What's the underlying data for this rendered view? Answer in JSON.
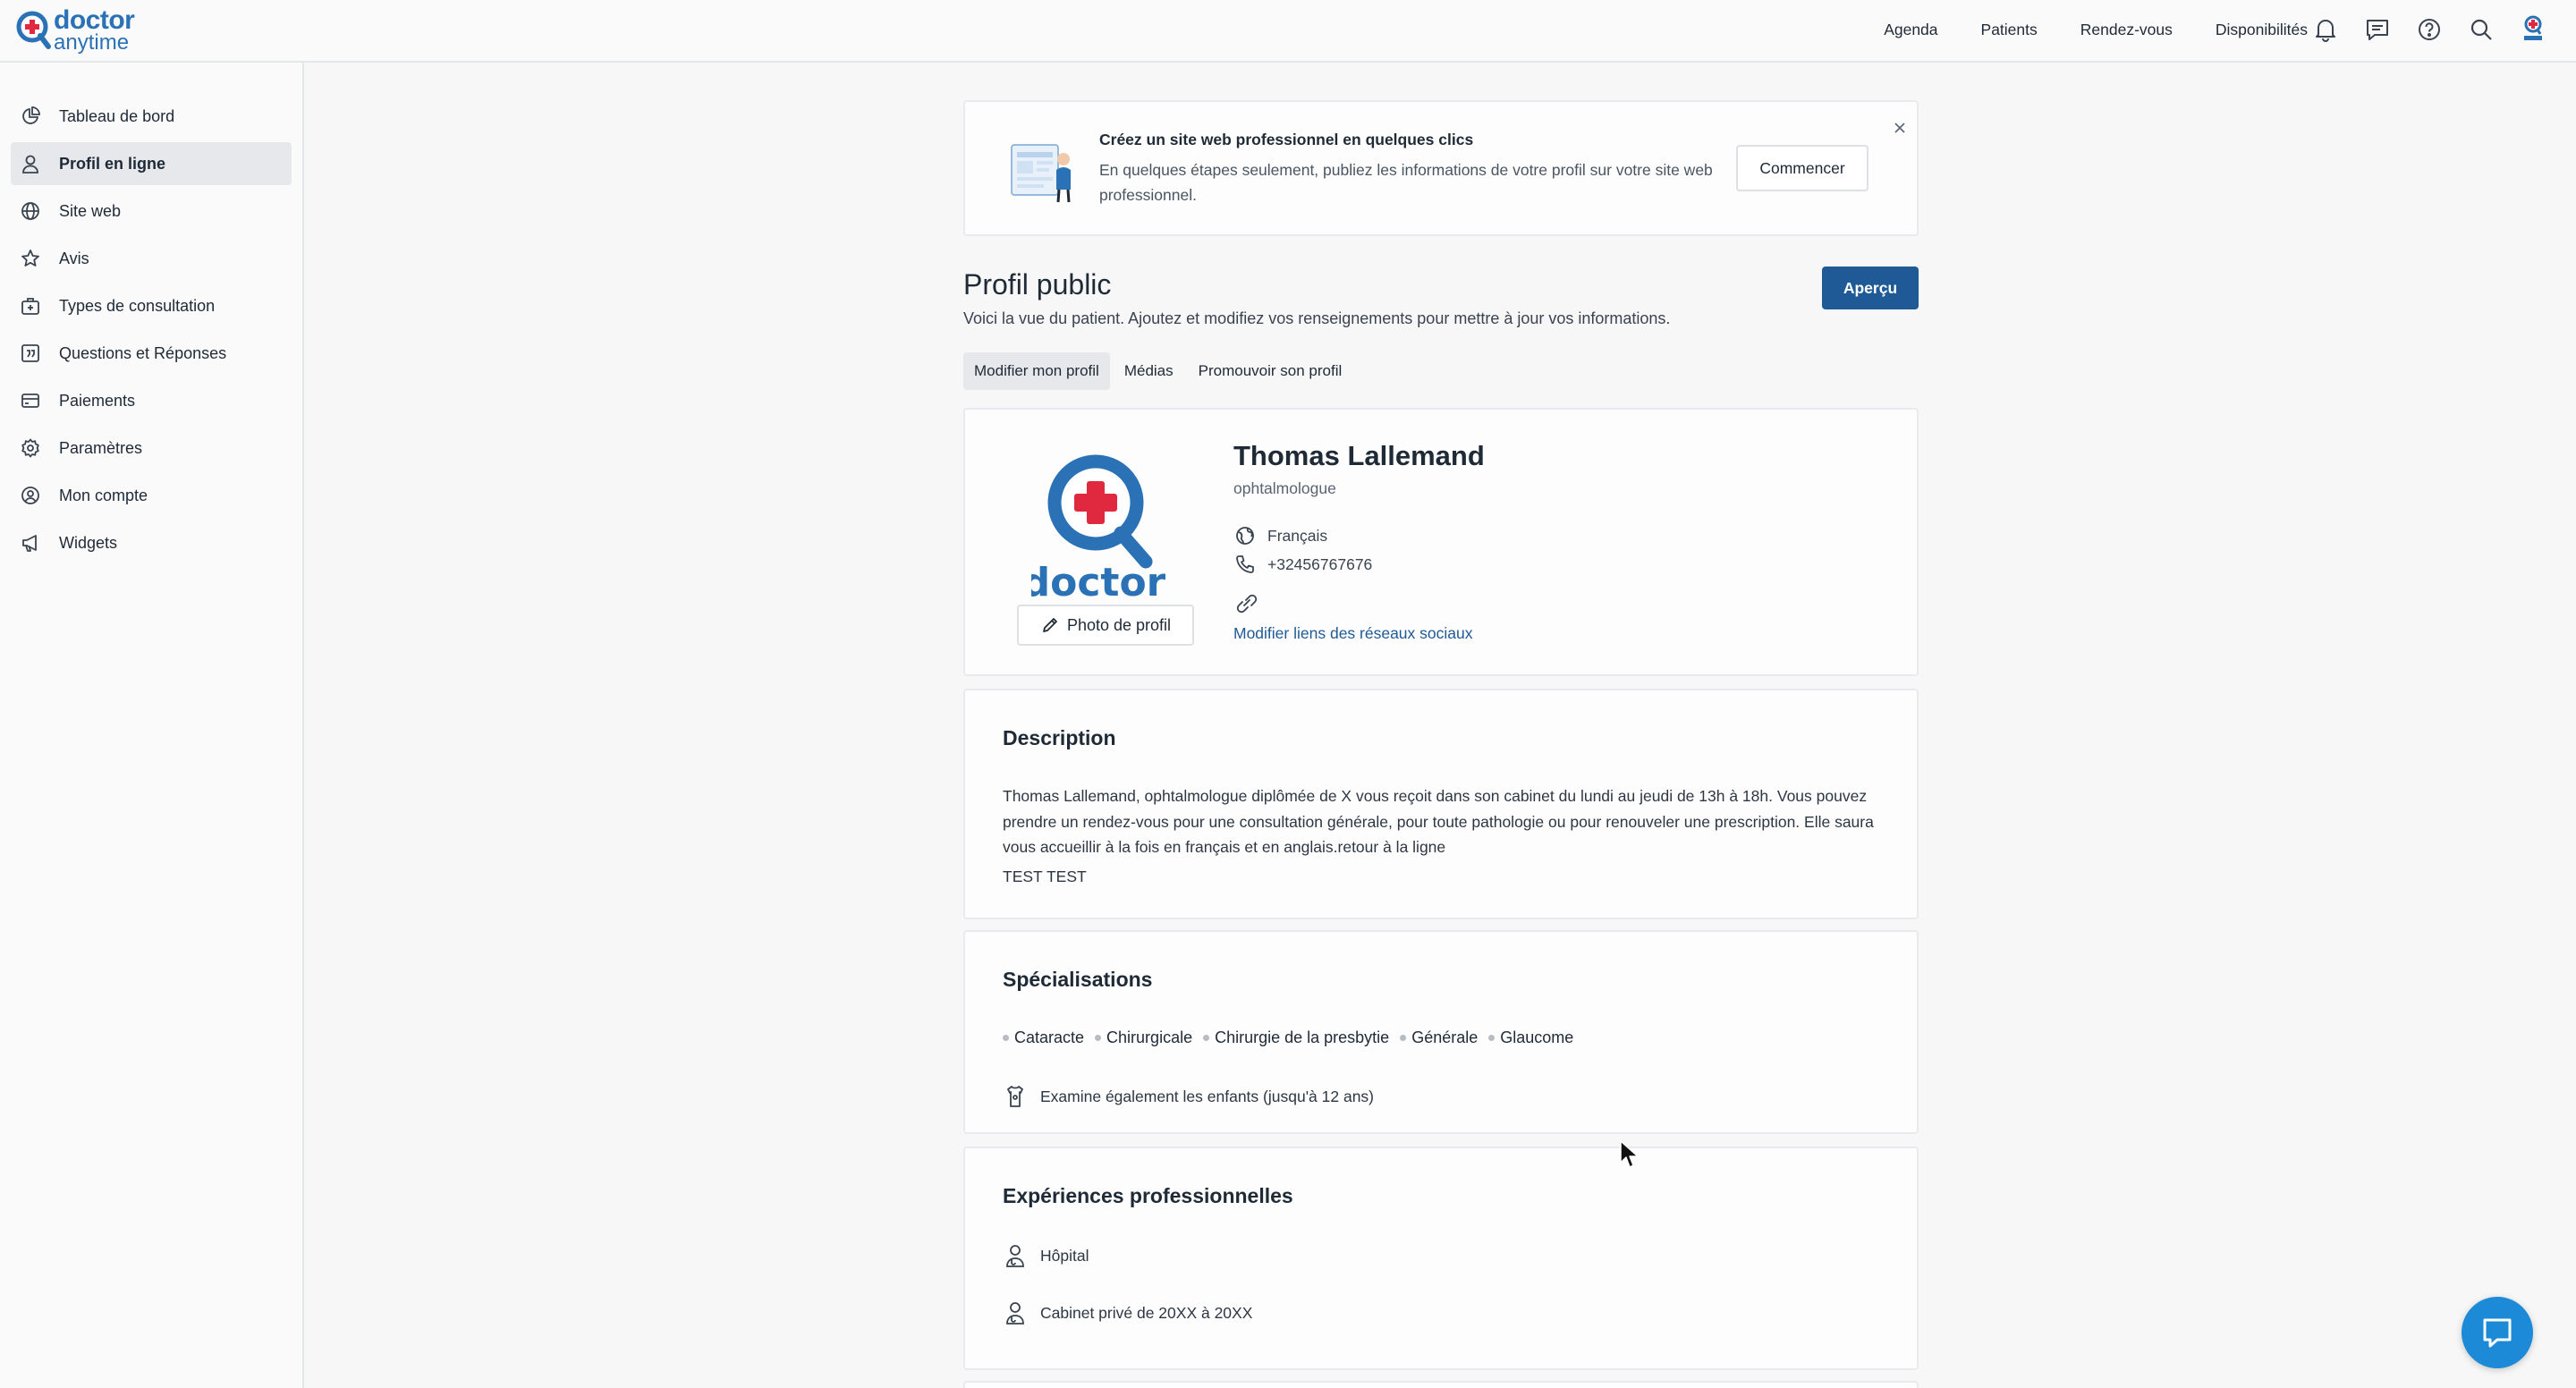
{
  "brand": {
    "line1": "doctor",
    "line2": "anytime",
    "color": "#2a72b5"
  },
  "nav": {
    "links": [
      "Agenda",
      "Patients",
      "Rendez-vous",
      "Disponibilités"
    ],
    "icons": [
      "bell-icon",
      "message-icon",
      "help-icon",
      "search-icon",
      "avatar-icon"
    ]
  },
  "sidebar": {
    "items": [
      {
        "label": "Tableau de bord",
        "icon": "pie-chart-icon",
        "active": false
      },
      {
        "label": "Profil en ligne",
        "icon": "user-icon",
        "active": true
      },
      {
        "label": "Site web",
        "icon": "globe-icon",
        "active": false
      },
      {
        "label": "Avis",
        "icon": "star-icon",
        "active": false
      },
      {
        "label": "Types de consultation",
        "icon": "medical-bag-icon",
        "active": false
      },
      {
        "label": "Questions et Réponses",
        "icon": "quote-icon",
        "active": false
      },
      {
        "label": "Paiements",
        "icon": "card-icon",
        "active": false
      },
      {
        "label": "Paramètres",
        "icon": "gear-icon",
        "active": false
      },
      {
        "label": "Mon compte",
        "icon": "account-icon",
        "active": false
      },
      {
        "label": "Widgets",
        "icon": "megaphone-icon",
        "active": false
      }
    ]
  },
  "banner": {
    "title": "Créez un site web professionnel en quelques clics",
    "text": "En quelques étapes seulement, publiez les informations de votre profil sur votre site web professionnel.",
    "button": "Commencer"
  },
  "page": {
    "title": "Profil public",
    "subtitle": "Voici la vue du patient. Ajoutez et modifiez vos renseignements pour mettre à jour vos informations.",
    "preview_button": "Aperçu",
    "tabs": [
      {
        "label": "Modifier mon profil",
        "active": true
      },
      {
        "label": "Médias",
        "active": false
      },
      {
        "label": "Promouvoir son profil",
        "active": false
      }
    ]
  },
  "profile": {
    "name": "Thomas Lallemand",
    "specialty": "ophtalmologue",
    "language": "Français",
    "phone": "+32456767676",
    "social_link": "Modifier liens des réseaux sociaux",
    "photo_button": "Photo de profil",
    "avatar_text": "doctor"
  },
  "description": {
    "title": "Description",
    "text": "Thomas Lallemand, ophtalmologue diplômée de X vous reçoit dans son cabinet du lundi au jeudi de 13h à 18h. Vous pouvez prendre un rendez-vous pour une consultation générale, pour toute pathologie ou pour renouveler une prescription. Elle saura vous accueillir à la fois en français et en anglais.retour à la ligne",
    "extra": "TEST TEST"
  },
  "specializations": {
    "title": "Spécialisations",
    "tags": [
      "Cataracte",
      "Chirurgicale",
      "Chirurgie de la presbytie",
      "Générale",
      "Glaucome"
    ],
    "children_note": "Examine également les enfants (jusqu'à 12 ans)"
  },
  "experience": {
    "title": "Expériences professionnelles",
    "items": [
      "Hôpital",
      "Cabinet privé de 20XX à 20XX"
    ]
  },
  "colors": {
    "primary": "#1f5a96",
    "brand_red": "#e0283e",
    "brand_blue": "#2a72b5",
    "chat": "#1c8ad6"
  }
}
